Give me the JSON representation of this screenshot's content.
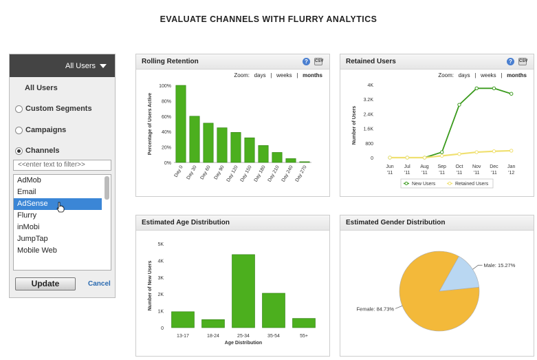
{
  "page_title": "EVALUATE CHANNELS WITH FLURRY ANALYTICS",
  "sidebar": {
    "dropdown_label": "All Users",
    "all_users": "All Users",
    "options": [
      {
        "label": "Custom Segments",
        "selected": false
      },
      {
        "label": "Campaigns",
        "selected": false
      },
      {
        "label": "Channels",
        "selected": true
      }
    ],
    "filter_placeholder": "<<enter text to filter>>",
    "channels": [
      "AdMob",
      "Email",
      "AdSense",
      "Flurry",
      "inMobi",
      "JumpTap",
      "Mobile Web"
    ],
    "selected_channel": "AdSense",
    "update_label": "Update",
    "cancel_label": "Cancel"
  },
  "zoom": {
    "label": "Zoom:",
    "days": "days",
    "weeks": "weeks",
    "months": "months",
    "sep": "|"
  },
  "icons": {
    "help": "help-icon",
    "csv": "csv-export-icon",
    "csv_text": "CSV",
    "help_text": "?"
  },
  "colors": {
    "bar_green": "#4caf1e",
    "line_green": "#3a9a1c",
    "line_yellow": "#f0e070",
    "pie_female": "#f3b93a",
    "pie_male": "#b9d7f2"
  },
  "panels": {
    "rolling_retention": "Rolling Retention",
    "retained_users": "Retained Users",
    "age_distribution": "Estimated Age Distribution",
    "gender_distribution": "Estimated Gender Distribution"
  },
  "chart_data": [
    {
      "type": "bar",
      "title": "Rolling Retention",
      "categories": [
        "Day 0",
        "Day 30",
        "Day 60",
        "Day 90",
        "Day 120",
        "Day 150",
        "Day 180",
        "Day 210",
        "Day 240",
        "Day 270"
      ],
      "values": [
        100,
        60,
        51,
        45,
        39,
        32,
        22,
        13,
        5,
        1
      ],
      "ylabel": "Percentage of Users Active",
      "yticks": [
        "0%",
        "20%",
        "40%",
        "60%",
        "80%",
        "100%"
      ],
      "ylim": [
        0,
        100
      ]
    },
    {
      "type": "line",
      "title": "Retained Users",
      "categories": [
        "Jun '11",
        "Jul '11",
        "Aug '11",
        "Sep '11",
        "Oct '11",
        "Nov '11",
        "Dec '11",
        "Jan '12"
      ],
      "x_top": [
        "Jun",
        "Jul",
        "Aug",
        "Sep",
        "Oct",
        "Nov",
        "Dec",
        "Jan"
      ],
      "x_bottom": [
        "'11",
        "'11",
        "'11",
        "'11",
        "'11",
        "'11",
        "'11",
        "'12"
      ],
      "series": [
        {
          "name": "New Users",
          "values": [
            0,
            0,
            0,
            300,
            2900,
            3800,
            3800,
            3500
          ]
        },
        {
          "name": "Retained Users",
          "values": [
            0,
            0,
            0,
            100,
            200,
            300,
            350,
            380
          ]
        }
      ],
      "ylabel": "Number of Users",
      "yticks": [
        "0",
        "800",
        "1.6K",
        "2.4K",
        "3.2K",
        "4K"
      ],
      "ylim": [
        0,
        4000
      ]
    },
    {
      "type": "bar",
      "title": "Estimated Age Distribution",
      "categories": [
        "13-17",
        "18-24",
        "25-34",
        "35-54",
        "55+"
      ],
      "values": [
        950,
        480,
        4350,
        2050,
        550
      ],
      "xlabel": "Age Distribution",
      "ylabel": "Number of New Users",
      "yticks": [
        "0",
        "1K",
        "2K",
        "3K",
        "4K",
        "5K"
      ],
      "ylim": [
        0,
        5000
      ]
    },
    {
      "type": "pie",
      "title": "Estimated Gender Distribution",
      "slices": [
        {
          "name": "Female",
          "value": 84.73,
          "label": "Female: 84.73%"
        },
        {
          "name": "Male",
          "value": 15.27,
          "label": "Male: 15.27%"
        }
      ]
    }
  ]
}
